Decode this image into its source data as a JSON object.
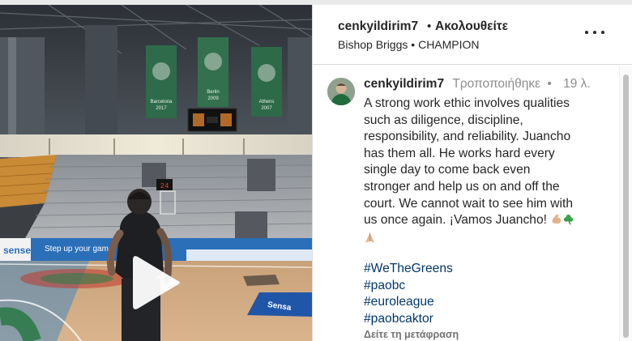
{
  "header": {
    "username": "cenkyildirim7",
    "separator": "•",
    "follow_status": "Ακολουθείτε",
    "audio_artist": "Bishop Briggs",
    "audio_separator": "•",
    "audio_title": "CHAMPION",
    "more_icon": "more-horizontal-icon"
  },
  "media": {
    "play_icon": "play-icon",
    "banner_left": "Barcelona\n2017",
    "banner_mid": "Berlin\n2009",
    "banner_right": "Athens\n2007",
    "arena_text": "Step up your game",
    "sponsor": "sense",
    "shot_clock": "24",
    "floor_logo": "Sensa"
  },
  "comment": {
    "username": "cenkyildirim7",
    "edited": "Τροποποιήθηκε",
    "separator": "•",
    "time": "19 λ.",
    "lines": [
      "A strong work ethic involves qualities",
      "such as diligence, discipline,",
      "responsibility, and reliability. Juancho",
      "has them all. He works hard every",
      "single day to come back even",
      "stronger and help us on and off the",
      "court. We cannot wait to see him with",
      "us once again. ¡Vamos Juancho!"
    ],
    "emojis": [
      "flexed-biceps",
      "shamrock",
      "folded-hands"
    ],
    "hashtags": [
      "#WeTheGreens",
      "#paobc",
      "#euroleague",
      "#paobcaktor"
    ],
    "translate": "Δείτε τη μετάφραση"
  }
}
